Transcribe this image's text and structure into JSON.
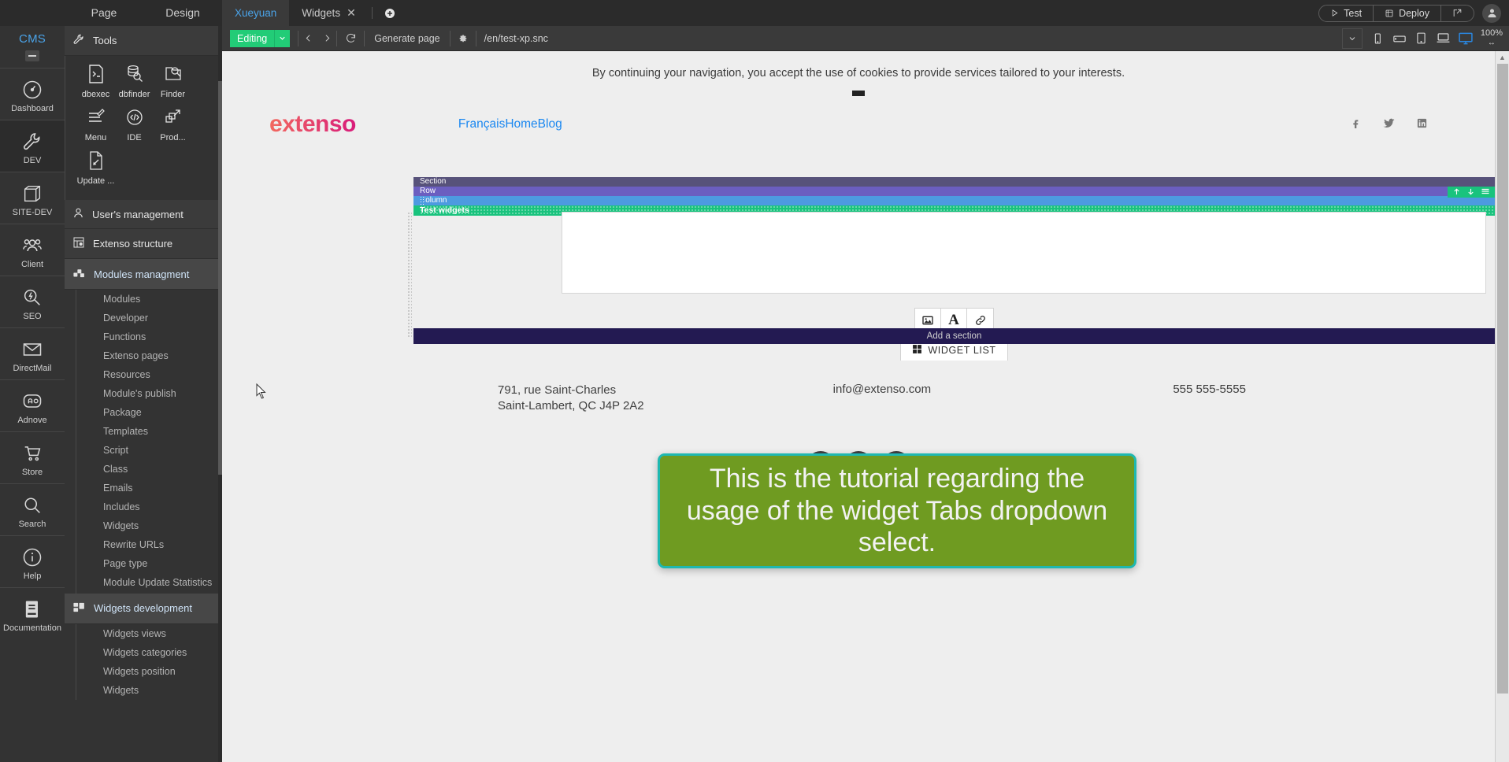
{
  "rail": {
    "title": "CMS",
    "items": [
      {
        "label": "Dashboard",
        "icon": "gauge-icon"
      },
      {
        "label": "DEV",
        "icon": "wrench-icon"
      },
      {
        "label": "SITE-DEV",
        "icon": "cube-icon"
      },
      {
        "label": "Client",
        "icon": "users-icon"
      },
      {
        "label": "SEO",
        "icon": "seo-magnifier-icon"
      },
      {
        "label": "DirectMail",
        "icon": "envelope-icon"
      },
      {
        "label": "Adnove",
        "icon": "ad-icon"
      },
      {
        "label": "Store",
        "icon": "cart-icon"
      },
      {
        "label": "Search",
        "icon": "magnifier-icon"
      },
      {
        "label": "Help",
        "icon": "info-icon"
      },
      {
        "label": "Documentation",
        "icon": "book-icon"
      }
    ]
  },
  "panel": {
    "tabs": [
      "Page",
      "Design"
    ],
    "tools": {
      "header": "Tools",
      "items": [
        {
          "label": "dbexec",
          "icon": "terminal-icon"
        },
        {
          "label": "dbfinder",
          "icon": "database-search-icon"
        },
        {
          "label": "Finder",
          "icon": "folder-search-icon"
        },
        {
          "label": "Menu",
          "icon": "menu-edit-icon"
        },
        {
          "label": "IDE",
          "icon": "code-icon"
        },
        {
          "label": "Prod...",
          "icon": "deploy-icon"
        },
        {
          "label": "Update ...",
          "icon": "file-edit-icon"
        }
      ]
    },
    "groups": [
      {
        "label": "User's management",
        "icon": "user-icon",
        "selected": false
      },
      {
        "label": "Extenso structure",
        "icon": "structure-icon",
        "selected": false
      },
      {
        "label": "Modules managment",
        "icon": "modules-icon",
        "selected": true
      }
    ],
    "modules_items": [
      "Modules",
      "Developer",
      "Functions",
      "Extenso pages",
      "Resources",
      "Module's publish",
      "Package",
      "Templates",
      "Script",
      "Class",
      "Emails",
      "Includes",
      "Widgets",
      "Rewrite URLs",
      "Page type",
      "Module Update Statistics"
    ],
    "widgets_dev": {
      "label": "Widgets development",
      "icon": "widgets-dev-icon",
      "items": [
        "Widgets views",
        "Widgets categories",
        "Widgets position",
        "Widgets"
      ]
    }
  },
  "topbar": {
    "tabs": [
      {
        "label": "Xueyuan",
        "active": true,
        "closable": false
      },
      {
        "label": "Widgets",
        "active": false,
        "closable": true
      }
    ],
    "new_tab_icon": "plus-circle-icon",
    "test_label": "Test",
    "deploy_label": "Deploy",
    "external_icon": "external-link-icon",
    "avatar_icon": "user-avatar-icon"
  },
  "urlbar": {
    "mode": "Editing",
    "mode_caret": "chevron-down-icon",
    "back_icon": "chevron-left-icon",
    "forward_icon": "chevron-right-icon",
    "refresh_icon": "refresh-icon",
    "generate_label": "Generate page",
    "settings_icon": "gear-icon",
    "url": "/en/test-xp.snc",
    "dropdown_icon": "chevron-down-icon",
    "devices": [
      "phone-icon",
      "phone-landscape-icon",
      "tablet-icon",
      "laptop-icon",
      "desktop-icon"
    ],
    "active_device": "desktop-icon",
    "zoom": "100%"
  },
  "site": {
    "cookie_notice": "By continuing your navigation, you accept the use of cookies to provide services tailored to your interests.",
    "logo": "extenso",
    "nav_links": "FrançaisHomeBlog",
    "socials": [
      "facebook-icon",
      "twitter-icon",
      "linkedin-icon"
    ],
    "editor_bars": {
      "section": "Section",
      "row": "Row",
      "column": "Column",
      "widget": "Test widgets",
      "widget_tools": [
        "arrow-up-icon",
        "arrow-down-icon",
        "hamburger-icon"
      ]
    },
    "widget_buttons": [
      {
        "icon": "image-icon"
      },
      {
        "icon": "text-icon"
      },
      {
        "icon": "link-icon"
      }
    ],
    "widget_list_label": "WIDGET LIST",
    "widget_list_icon": "grid-icon",
    "add_section_label": "Add a section",
    "footer": {
      "address_line1": "791, rue Saint-Charles",
      "address_line2": "Saint-Lambert, QC J4P 2A2",
      "email": "info@extenso.com",
      "phone": "555 555-5555"
    }
  },
  "tutorial": {
    "text": "This is the tutorial regarding the usage of the widget Tabs dropdown select."
  },
  "colors": {
    "accent_green": "#22cc77",
    "tutorial_bg": "#6f9b21",
    "tutorial_border": "#1eb8b0",
    "section_bar": "#57527a",
    "row_bar": "#6b5ec0",
    "column_bar": "#4d9ae0",
    "widget_bar": "#19c37d",
    "add_section_bar": "#231a52",
    "link_blue": "#1a87f0"
  }
}
